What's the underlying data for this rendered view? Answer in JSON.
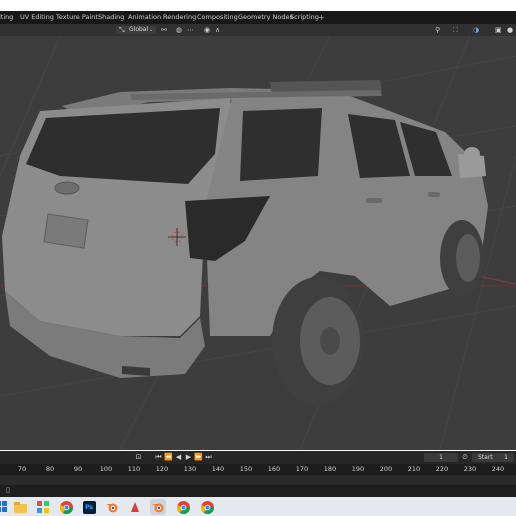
{
  "tabs": [
    "lting",
    "UV Editing",
    "Texture Paint",
    "Shading",
    "Animation",
    "Rendering",
    "Compositing",
    "Geometry Nodes",
    "Scripting"
  ],
  "tab_add": "+",
  "viewport_header": {
    "orientation_label": "Global"
  },
  "timeline": {
    "current_frame": "1",
    "start_label": "Start",
    "start_value": "1",
    "ruler_ticks": [
      "70",
      "80",
      "90",
      "100",
      "110",
      "120",
      "130",
      "140",
      "150",
      "160",
      "170",
      "180",
      "190",
      "200",
      "210",
      "220",
      "230",
      "240"
    ]
  },
  "taskbar_apps": [
    "windows-start-icon",
    "file-explorer-icon",
    "app-grid-icon",
    "chrome-icon",
    "photoshop-icon",
    "blender-icon",
    "red-app-icon",
    "blender-active-icon",
    "chrome-icon-2",
    "chrome-icon-3"
  ],
  "photoshop_label": "Ps",
  "colors": {
    "viewport_bg": "#3d3d3d",
    "car_body": "#8a8a8a",
    "axis_red": "#b03a3a",
    "taskbar_bg": "#e4e8ef"
  }
}
